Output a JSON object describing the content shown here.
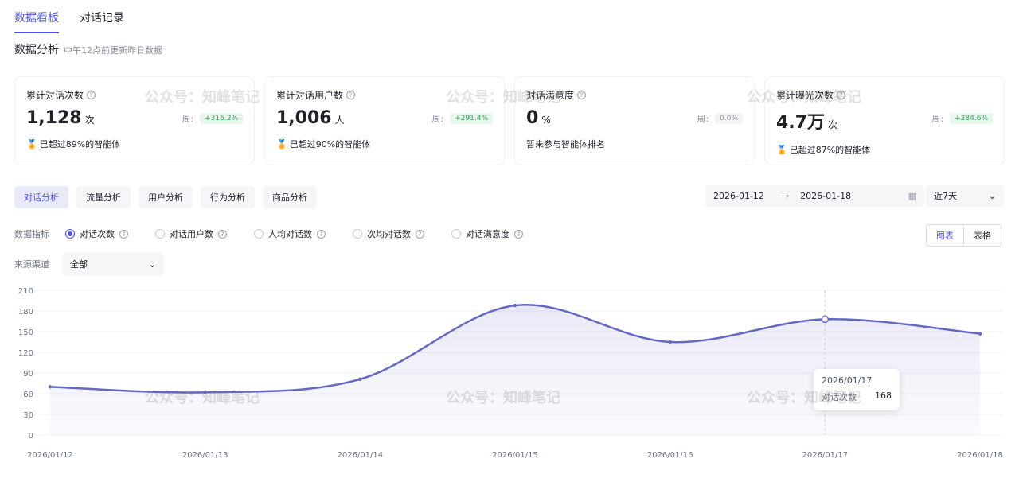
{
  "tabs": [
    {
      "label": "数据看板",
      "active": true
    },
    {
      "label": "对话记录",
      "active": false
    }
  ],
  "section": {
    "title": "数据分析",
    "subtitle": "中午12点前更新昨日数据"
  },
  "cards": [
    {
      "label": "累计对话次数",
      "value": "1,128",
      "unit": "次",
      "week_label": "周:",
      "change": "+316.2%",
      "change_type": "up",
      "rank": "已超过89%的智能体"
    },
    {
      "label": "累计对话用户数",
      "value": "1,006",
      "unit": "人",
      "week_label": "周:",
      "change": "+291.4%",
      "change_type": "up",
      "rank": "已超过90%的智能体"
    },
    {
      "label": "对话满意度",
      "value": "0",
      "unit": "%",
      "week_label": "周:",
      "change": "0.0%",
      "change_type": "neutral",
      "rank": "暂未参与智能体排名"
    },
    {
      "label": "累计曝光次数",
      "value": "4.7万",
      "unit": "次",
      "week_label": "周:",
      "change": "+284.6%",
      "change_type": "up",
      "rank": "已超过87%的智能体"
    }
  ],
  "analysis_tabs": [
    {
      "label": "对话分析",
      "active": true
    },
    {
      "label": "流量分析",
      "active": false
    },
    {
      "label": "用户分析",
      "active": false
    },
    {
      "label": "行为分析",
      "active": false
    },
    {
      "label": "商品分析",
      "active": false
    }
  ],
  "date_range": {
    "start": "2026-01-12",
    "arrow": "→",
    "end": "2026-01-18"
  },
  "period": {
    "selected": "近7天"
  },
  "metrics": {
    "label": "数据指标",
    "options": [
      {
        "label": "对话次数",
        "selected": true
      },
      {
        "label": "对话用户数",
        "selected": false
      },
      {
        "label": "人均对话数",
        "selected": false
      },
      {
        "label": "次均对话数",
        "selected": false
      },
      {
        "label": "对话满意度",
        "selected": false
      }
    ]
  },
  "view_toggle": {
    "chart": "图表",
    "table": "表格",
    "active": "chart"
  },
  "source": {
    "label": "来源渠道",
    "selected": "全部"
  },
  "tooltip": {
    "date": "2026/01/17",
    "series": "对话次数",
    "value": "168"
  },
  "watermark": "公众号：知峰笔记",
  "colors": {
    "accent": "#4d53e8",
    "line": "#6468c4",
    "up": "#2ea154"
  },
  "chart_data": {
    "type": "area",
    "x": [
      "2026/01/12",
      "2026/01/13",
      "2026/01/14",
      "2026/01/15",
      "2026/01/16",
      "2026/01/17",
      "2026/01/18"
    ],
    "series": [
      {
        "name": "对话次数",
        "values": [
          70,
          62,
          81,
          188,
          135,
          168,
          147
        ]
      }
    ],
    "yticks": [
      0,
      30,
      60,
      90,
      120,
      150,
      180,
      210
    ],
    "ylim": [
      0,
      210
    ],
    "grid": true,
    "highlight_index": 5
  }
}
